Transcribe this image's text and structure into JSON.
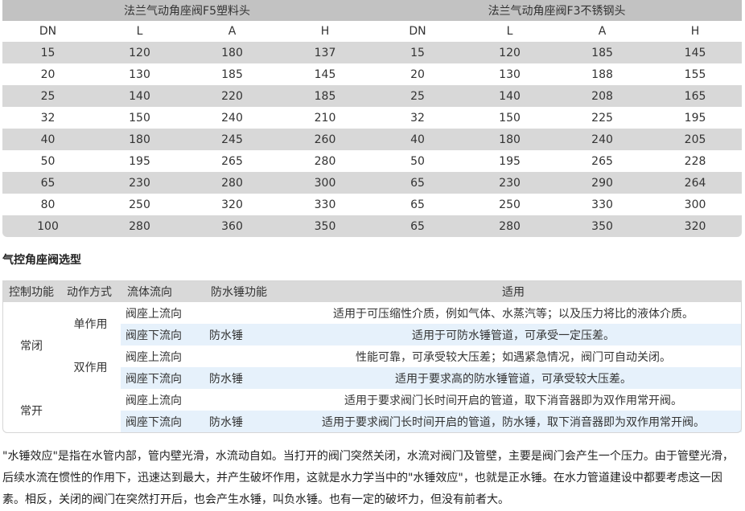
{
  "table1": {
    "group_left": "法兰气动角座阀F5塑料头",
    "group_right": "法兰气动角座阀F3不锈钢头",
    "columns": [
      "DN",
      "L",
      "A",
      "H",
      "DN",
      "L",
      "A",
      "H"
    ],
    "rows": [
      [
        "15",
        "120",
        "180",
        "137",
        "15",
        "120",
        "185",
        "145"
      ],
      [
        "20",
        "130",
        "185",
        "145",
        "20",
        "130",
        "188",
        "155"
      ],
      [
        "25",
        "140",
        "220",
        "185",
        "25",
        "140",
        "208",
        "165"
      ],
      [
        "32",
        "150",
        "240",
        "210",
        "32",
        "150",
        "225",
        "195"
      ],
      [
        "40",
        "180",
        "245",
        "260",
        "40",
        "180",
        "240",
        "205"
      ],
      [
        "50",
        "195",
        "265",
        "280",
        "50",
        "195",
        "265",
        "228"
      ],
      [
        "65",
        "230",
        "280",
        "300",
        "65",
        "230",
        "290",
        "264"
      ],
      [
        "80",
        "250",
        "320",
        "330",
        "65",
        "250",
        "330",
        "300"
      ],
      [
        "100",
        "280",
        "360",
        "350",
        "65",
        "280",
        "350",
        "320"
      ]
    ]
  },
  "section_title": "气控角座阀选型",
  "table2": {
    "headers": [
      "控制功能",
      "动作方式",
      "流体流向",
      "防水锤功能",
      "适用"
    ],
    "normally_closed": "常闭",
    "normally_open": "常开",
    "single_acting": "单作用",
    "double_acting": "双作用",
    "rows": [
      {
        "flow": "阀座上流向",
        "hammer": "",
        "usage": "适用于可压缩性介质，例如气体、水蒸汽等；以及压力将比的液体介质。"
      },
      {
        "flow": "阀座下流向",
        "hammer": "防水锤",
        "usage": "适用于可防水锤管道，可承受一定压差。"
      },
      {
        "flow": "阀座上流向",
        "hammer": "",
        "usage": "性能可靠，可承受较大压差；如遇紧急情况，阀门可自动关闭。"
      },
      {
        "flow": "阀座下流向",
        "hammer": "防水锤",
        "usage": "适用于要求高的防水锤管道，可承受较大压差。"
      },
      {
        "flow": "阀座上流向",
        "hammer": "",
        "usage": "适用于要求阀门长时间开启的管道，取下消音器即为双作用常开阀。"
      },
      {
        "flow": "阀座下流向",
        "hammer": "防水锤",
        "usage": "适用于要求阀门长时间开启的管道，防水锤，取下消音器即为双作用常开阀。"
      }
    ]
  },
  "paragraph": "\"水锤效应\"是指在水管内部，管内壁光滑，水流动自如。当打开的阀门突然关闭，水流对阀门及管壁，主要是阀门会产生一个压力。由于管壁光滑，后续水流在惯性的作用下，迅速达到最大，并产生破坏作用，这就是水力学当中的\"水锤效应\"，也就是正水锤。在水力管道建设中都要考虑这一因素。相反，关闭的阀门在突然打开后，也会产生水锤，叫负水锤。也有一定的破坏力，但没有前者大。"
}
